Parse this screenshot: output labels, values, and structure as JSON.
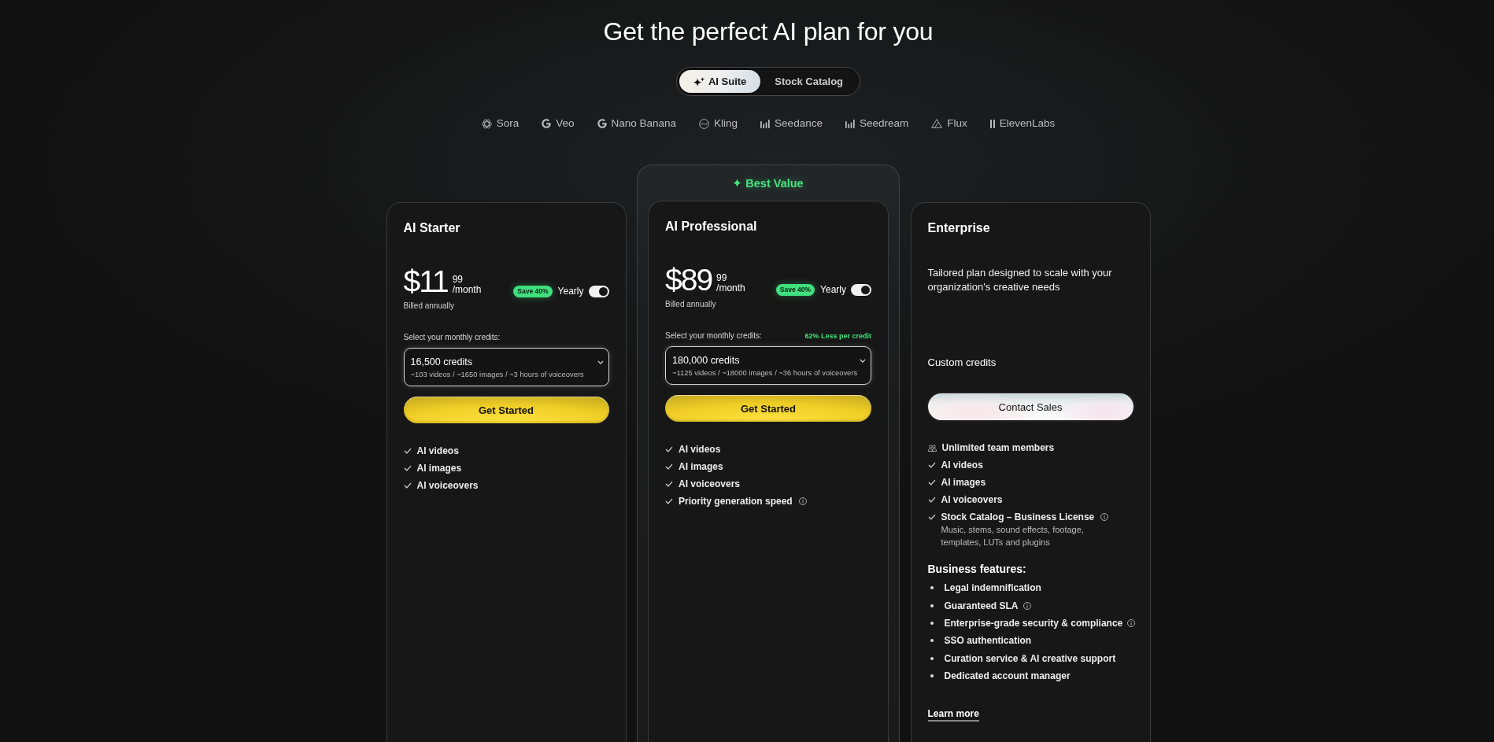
{
  "header": {
    "title": "Get the perfect AI plan for you"
  },
  "catalog_tabs": [
    {
      "label": "AI Suite",
      "selected": true
    },
    {
      "label": "Stock Catalog",
      "selected": false
    }
  ],
  "models": [
    "Sora",
    "Veo",
    "Nano Banana",
    "Kling",
    "Seedance",
    "Seedream",
    "Flux",
    "ElevenLabs"
  ],
  "plans": [
    {
      "kind": "self_serve",
      "title": "AI Starter",
      "price": "$11",
      "price_cents": "99",
      "price_period": "/month",
      "billing_note": "Billed annually",
      "discount_badge": "Save 40%",
      "billing_switch": {
        "label": "Yearly",
        "on": true
      },
      "credits_label": "Select your monthly credits:",
      "credits_select": {
        "value": "16,500 credits",
        "detail": "~103 videos / ~1650 images / ~3 hours of voiceovers"
      },
      "button": "Get Started",
      "features": [
        {
          "kind": "check",
          "label": "AI videos",
          "info": false
        },
        {
          "kind": "check",
          "label": "AI images",
          "info": false
        },
        {
          "kind": "check",
          "label": "AI voiceovers",
          "info": false
        }
      ]
    },
    {
      "kind": "self_serve",
      "ribbon": "Best Value",
      "title": "AI Professional",
      "price": "$89",
      "price_cents": "99",
      "price_period": "/month",
      "billing_note": "Billed annually",
      "discount_badge": "Save 40%",
      "billing_switch": {
        "label": "Yearly",
        "on": true
      },
      "credits_label": "Select your monthly credits:",
      "credits_note": "62% Less per credit",
      "credits_select": {
        "value": "180,000 credits",
        "detail": "~1125 videos / ~18000 images / ~36 hours of voiceovers"
      },
      "button": "Get Started",
      "features": [
        {
          "kind": "check",
          "label": "AI videos",
          "info": false
        },
        {
          "kind": "check",
          "label": "AI images",
          "info": false
        },
        {
          "kind": "check",
          "label": "AI voiceovers",
          "info": false
        },
        {
          "kind": "check",
          "label": "Priority generation speed",
          "info": true
        }
      ]
    },
    {
      "kind": "enterprise",
      "title": "Enterprise",
      "description": "Tailored plan designed to scale with your organization's creative needs",
      "credits": "Custom credits",
      "button": "Contact Sales",
      "features": [
        {
          "kind": "team",
          "label": "Unlimited team members",
          "info": false
        },
        {
          "kind": "check",
          "label": "AI videos",
          "info": false
        },
        {
          "kind": "check",
          "label": "AI images",
          "info": false
        },
        {
          "kind": "check",
          "label": "AI voiceovers",
          "info": false
        },
        {
          "kind": "check",
          "label": "Stock Catalog – Business License",
          "info": true,
          "detail": "Music, stems, sound effects, footage, templates, LUTs and plugins"
        }
      ],
      "business_features": {
        "title": "Business features:",
        "items": [
          {
            "label": "Legal indemnification",
            "info": false
          },
          {
            "label": "Guaranteed SLA",
            "info": true
          },
          {
            "label": "Enterprise-grade security & compliance",
            "info": true
          },
          {
            "label": "SSO authentication",
            "info": false
          },
          {
            "label": "Curation service & AI creative support",
            "info": false
          },
          {
            "label": "Dedicated account manager",
            "info": false
          }
        ]
      },
      "link": "Learn more"
    }
  ]
}
